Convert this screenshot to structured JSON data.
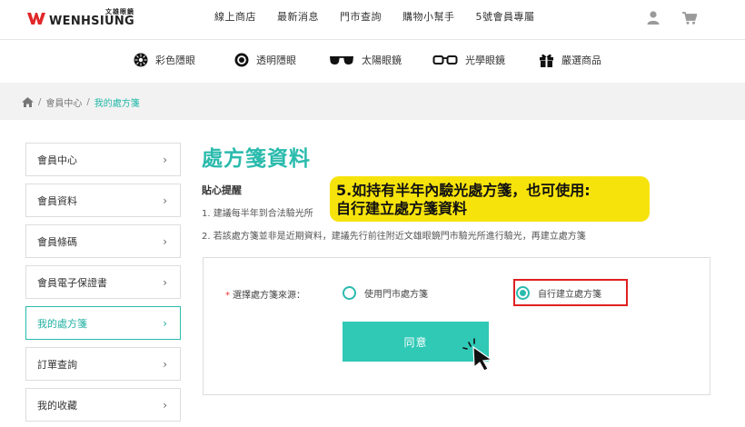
{
  "brand": {
    "logo_small": "文雄眼鏡",
    "logo_main": "WENHSIUNG",
    "logo_color": "#e0282a"
  },
  "top_nav": [
    "線上商店",
    "最新消息",
    "門市查詢",
    "購物小幫手",
    "5號會員專屬"
  ],
  "header_icons": [
    "user-icon",
    "cart-icon"
  ],
  "categories": [
    {
      "label": "彩色隱眼",
      "icon": "color-lens-icon"
    },
    {
      "label": "透明隱眼",
      "icon": "clear-lens-icon"
    },
    {
      "label": "太陽眼鏡",
      "icon": "sunglasses-icon"
    },
    {
      "label": "光學眼鏡",
      "icon": "optical-glasses-icon"
    },
    {
      "label": "嚴選商品",
      "icon": "gift-icon"
    }
  ],
  "breadcrumb": {
    "home_icon": "home-icon",
    "items": [
      "會員中心",
      "我的處方箋"
    ]
  },
  "sidebar": {
    "items": [
      {
        "label": "會員中心"
      },
      {
        "label": "會員資料"
      },
      {
        "label": "會員條碼"
      },
      {
        "label": "會員電子保證書"
      },
      {
        "label": "我的處方箋",
        "active": true
      },
      {
        "label": "訂單查詢"
      },
      {
        "label": "我的收藏"
      }
    ],
    "chevron": "›"
  },
  "main": {
    "title": "處方箋資料",
    "tips_title": "貼心提醒",
    "tips": [
      "1. 建議每半年到合法驗光所",
      "2. 若該處方箋並非是近期資料，建議先行前往附近文雄眼鏡門市驗光所進行驗光，再建立處方箋"
    ]
  },
  "callout": {
    "line1": "5.如持有半年內驗光處方箋，也可使用:",
    "line2": "自行建立處方箋資料",
    "color": "#f7e30c"
  },
  "form": {
    "required_mark": "*",
    "source_label": "選擇處方箋來源：",
    "options": [
      {
        "label": "使用門市處方箋",
        "checked": false
      },
      {
        "label": "自行建立處方箋",
        "checked": true
      }
    ],
    "agree_button": "同意",
    "accent_color": "#2bbbad",
    "highlight_color": "#e02020"
  }
}
